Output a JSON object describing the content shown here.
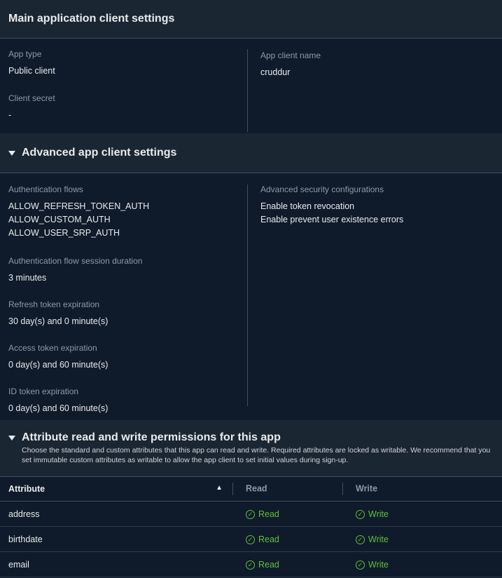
{
  "main_settings": {
    "title": "Main application client settings",
    "app_type_label": "App type",
    "app_type_value": "Public client",
    "client_secret_label": "Client secret",
    "client_secret_value": "-",
    "app_client_name_label": "App client name",
    "app_client_name_value": "cruddur"
  },
  "advanced_settings": {
    "title": "Advanced app client settings",
    "auth_flows_label": "Authentication flows",
    "auth_flows": [
      "ALLOW_REFRESH_TOKEN_AUTH",
      "ALLOW_CUSTOM_AUTH",
      "ALLOW_USER_SRP_AUTH"
    ],
    "session_duration_label": "Authentication flow session duration",
    "session_duration_value": "3 minutes",
    "refresh_label": "Refresh token expiration",
    "refresh_value": "30 day(s) and 0 minute(s)",
    "access_label": "Access token expiration",
    "access_value": "0 day(s) and 60 minute(s)",
    "id_label": "ID token expiration",
    "id_value": "0 day(s) and 60 minute(s)",
    "security_label": "Advanced security configurations",
    "security_items": [
      "Enable token revocation",
      "Enable prevent user existence errors"
    ]
  },
  "attributes": {
    "title": "Attribute read and write permissions for this app",
    "description": "Choose the standard and custom attributes that this app can read and write. Required attributes are locked as writable. We recommend that you set immutable custom attributes as writable to allow the app client to set initial values during sign-up.",
    "columns": [
      "Attribute",
      "Read",
      "Write"
    ],
    "rows": [
      {
        "attribute": "address",
        "read": "Read",
        "write": "Write"
      },
      {
        "attribute": "birthdate",
        "read": "Read",
        "write": "Write"
      },
      {
        "attribute": "email",
        "read": "Read",
        "write": "Write"
      }
    ]
  }
}
